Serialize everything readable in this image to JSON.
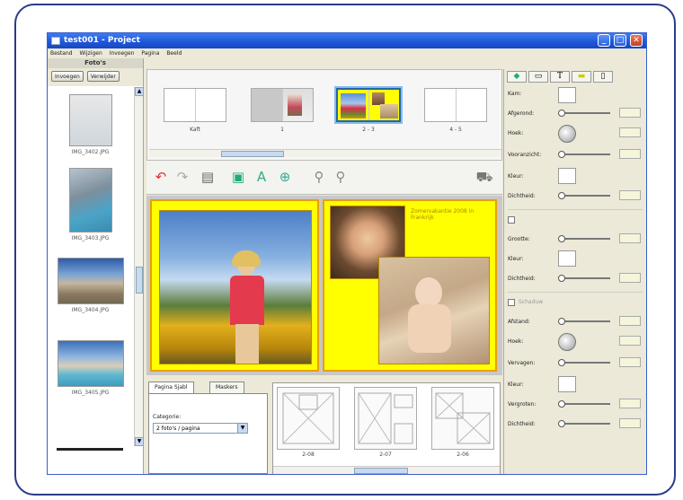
{
  "window": {
    "title": "test001 - Project"
  },
  "menu": [
    "Bestand",
    "Wijzigen",
    "Invoegen",
    "Pagina",
    "Beeld"
  ],
  "photos_panel": {
    "header": "Foto's",
    "insert_button": "Invoegen",
    "remove_button": "Verwijder",
    "items": [
      {
        "name": "IMG_3402.JPG"
      },
      {
        "name": "IMG_3403.JPG"
      },
      {
        "name": "IMG_3404.JPG"
      },
      {
        "name": "IMG_3405.JPG"
      }
    ]
  },
  "pages_strip": {
    "spreads": [
      {
        "label": "Kaft"
      },
      {
        "label": "1"
      },
      {
        "label": "2 - 3"
      },
      {
        "label": "4 - 5"
      }
    ]
  },
  "canvas": {
    "caption_text": "Zomervakantie 2008 in Frankrijk"
  },
  "bottom_panel": {
    "tabs": [
      "Pagina Sjabl",
      "Maskers"
    ],
    "category_label": "Categorie:",
    "category_value": "2 foto's / pagina",
    "layouts": [
      {
        "label": "2-08"
      },
      {
        "label": "2-07"
      },
      {
        "label": "2-06"
      }
    ]
  },
  "properties_panel": {
    "section1": [
      "Kam:",
      "Afgerond:",
      "Hoek:",
      "Vooranzicht:",
      "Kleur:",
      "Dichtheid:"
    ],
    "section2": [
      "Grootte:",
      "Kleur:",
      "Dichtheid:"
    ],
    "section2_check": "",
    "section3": [
      "Afstand:",
      "Hoek:",
      "Vervagen:",
      "Kleur:",
      "Vergroten:",
      "Dichtheid:"
    ],
    "section3_check": "Schaduw"
  }
}
